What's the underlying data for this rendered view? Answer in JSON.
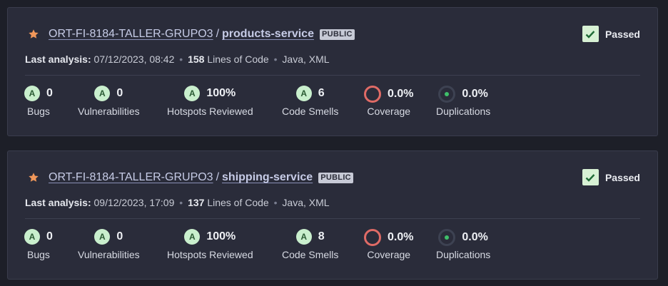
{
  "colors": {
    "background": "#1d1f28",
    "card": "#2a2c3a",
    "rating_a": "#c9efcd",
    "coverage_ring": "#e06b66",
    "duplication_dot": "#3fbf6a",
    "star": "#f0975a"
  },
  "projects": [
    {
      "organization": "ORT-FI-8184-TALLER-GRUPO3",
      "separator": "/",
      "name": "products-service",
      "visibility": "PUBLIC",
      "quality_gate": "Passed",
      "last_analysis_label": "Last analysis:",
      "last_analysis_date": "07/12/2023, 08:42",
      "lines_of_code": "158",
      "lines_of_code_label": "Lines of Code",
      "languages": "Java, XML",
      "metrics": {
        "bugs": {
          "rating": "A",
          "value": "0",
          "label": "Bugs"
        },
        "vulnerabilities": {
          "rating": "A",
          "value": "0",
          "label": "Vulnerabilities"
        },
        "hotspots": {
          "rating": "A",
          "value": "100%",
          "label": "Hotspots Reviewed"
        },
        "code_smells": {
          "rating": "A",
          "value": "6",
          "label": "Code Smells"
        },
        "coverage": {
          "value": "0.0%",
          "label": "Coverage"
        },
        "duplications": {
          "value": "0.0%",
          "label": "Duplications"
        }
      }
    },
    {
      "organization": "ORT-FI-8184-TALLER-GRUPO3",
      "separator": "/",
      "name": "shipping-service",
      "visibility": "PUBLIC",
      "quality_gate": "Passed",
      "last_analysis_label": "Last analysis:",
      "last_analysis_date": "09/12/2023, 17:09",
      "lines_of_code": "137",
      "lines_of_code_label": "Lines of Code",
      "languages": "Java, XML",
      "metrics": {
        "bugs": {
          "rating": "A",
          "value": "0",
          "label": "Bugs"
        },
        "vulnerabilities": {
          "rating": "A",
          "value": "0",
          "label": "Vulnerabilities"
        },
        "hotspots": {
          "rating": "A",
          "value": "100%",
          "label": "Hotspots Reviewed"
        },
        "code_smells": {
          "rating": "A",
          "value": "8",
          "label": "Code Smells"
        },
        "coverage": {
          "value": "0.0%",
          "label": "Coverage"
        },
        "duplications": {
          "value": "0.0%",
          "label": "Duplications"
        }
      }
    }
  ]
}
